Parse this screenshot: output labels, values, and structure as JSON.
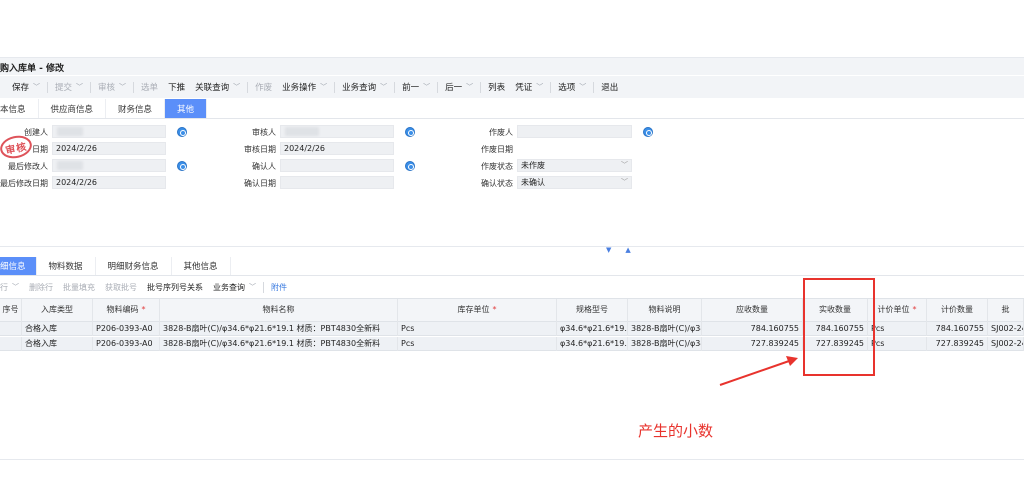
{
  "window": {
    "title": "购入库单 - 修改"
  },
  "toolbar": {
    "items": [
      {
        "label": "保存",
        "chevron": true,
        "disabled": false
      },
      {
        "label": "提交",
        "chevron": true,
        "disabled": true
      },
      {
        "label": "审核",
        "chevron": true,
        "disabled": true
      },
      {
        "label": "选单",
        "chevron": false,
        "disabled": true
      },
      {
        "label": "下推",
        "chevron": false,
        "disabled": false
      },
      {
        "label": "关联查询",
        "chevron": true,
        "disabled": false
      },
      {
        "label": "作废",
        "chevron": false,
        "disabled": true
      },
      {
        "label": "业务操作",
        "chevron": true,
        "disabled": false
      },
      {
        "label": "业务查询",
        "chevron": true,
        "disabled": false
      },
      {
        "label": "前一",
        "chevron": true,
        "disabled": false
      },
      {
        "label": "后一",
        "chevron": true,
        "disabled": false
      },
      {
        "label": "列表",
        "chevron": false,
        "disabled": false
      },
      {
        "label": "凭证",
        "chevron": true,
        "disabled": false
      },
      {
        "label": "选项",
        "chevron": true,
        "disabled": false
      },
      {
        "label": "退出",
        "chevron": false,
        "disabled": false
      }
    ]
  },
  "top_tabs": [
    {
      "label": "本信息",
      "active": false
    },
    {
      "label": "供应商信息",
      "active": false
    },
    {
      "label": "财务信息",
      "active": false
    },
    {
      "label": "其他",
      "active": true
    }
  ],
  "stamp": {
    "text": "审核"
  },
  "form": {
    "col1": [
      {
        "label": "创建人",
        "value": ""
      },
      {
        "label": "日期",
        "value": "2024/2/26"
      },
      {
        "label": "最后修改人",
        "value": ""
      },
      {
        "label": "最后修改日期",
        "value": "2024/2/26"
      }
    ],
    "col2": [
      {
        "label": "审核人",
        "value": ""
      },
      {
        "label": "审核日期",
        "value": "2024/2/26"
      },
      {
        "label": "确认人",
        "value": ""
      },
      {
        "label": "确认日期",
        "value": ""
      }
    ],
    "col3": [
      {
        "label": "作废人",
        "value": ""
      },
      {
        "label": "作废日期",
        "value": ""
      },
      {
        "label": "作废状态",
        "value": "未作废"
      },
      {
        "label": "确认状态",
        "value": "未确认"
      }
    ]
  },
  "bottom_tabs": [
    {
      "label": "细信息",
      "active": true
    },
    {
      "label": "物料数据",
      "active": false
    },
    {
      "label": "明细财务信息",
      "active": false
    },
    {
      "label": "其他信息",
      "active": false
    }
  ],
  "grid_toolbar": [
    {
      "label": "行",
      "disabled": true,
      "chevron": true
    },
    {
      "label": "删除行",
      "disabled": true,
      "chevron": false
    },
    {
      "label": "批量填充",
      "disabled": true,
      "chevron": false
    },
    {
      "label": "获取批号",
      "disabled": true,
      "chevron": false
    },
    {
      "label": "批号序列号关系",
      "disabled": false,
      "chevron": false
    },
    {
      "label": "业务查询",
      "disabled": false,
      "chevron": true
    },
    {
      "label": "附件",
      "disabled": false,
      "chevron": false,
      "link": true
    }
  ],
  "grid": {
    "columns": [
      {
        "label": "序号",
        "required": false
      },
      {
        "label": "入库类型",
        "required": false
      },
      {
        "label": "物料编码",
        "required": true
      },
      {
        "label": "物料名称",
        "required": false
      },
      {
        "label": "库存单位",
        "required": true
      },
      {
        "label": "规格型号",
        "required": false
      },
      {
        "label": "物料说明",
        "required": false
      },
      {
        "label": "应收数量",
        "required": false
      },
      {
        "label": "实收数量",
        "required": false
      },
      {
        "label": "计价单位",
        "required": true
      },
      {
        "label": "计价数量",
        "required": false
      },
      {
        "label": "批",
        "required": false
      }
    ],
    "rows": [
      [
        "",
        "合格入库",
        "P206-0393-A0",
        "3828-B扇叶(C)/φ34.6*φ21.6*19.1 材质：PBT4830全新料",
        "Pcs",
        "φ34.6*φ21.6*19.1",
        "3828-B扇叶(C)/φ34.6*φ21.",
        "784.160755",
        "784.160755",
        "Pcs",
        "784.160755",
        "SJ002-24"
      ],
      [
        "",
        "合格入库",
        "P206-0393-A0",
        "3828-B扇叶(C)/φ34.6*φ21.6*19.1 材质：PBT4830全新料",
        "Pcs",
        "φ34.6*φ21.6*19.1",
        "3828-B扇叶(C)/φ34.6*φ21.",
        "727.839245",
        "727.839245",
        "Pcs",
        "727.839245",
        "SJ002-24"
      ]
    ]
  },
  "annotation": {
    "text": "产生的小数",
    "color": "#e8332d"
  },
  "colors": {
    "accent": "#5b8ff9",
    "annotation_red": "#e8332d"
  }
}
